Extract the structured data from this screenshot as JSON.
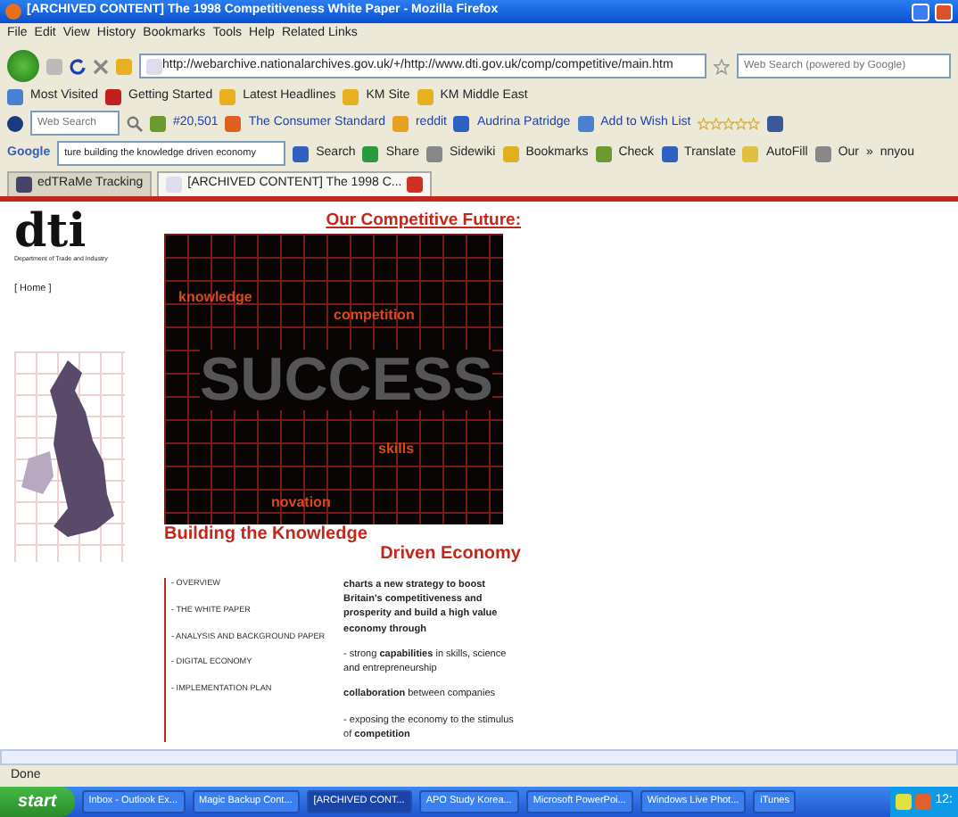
{
  "window": {
    "title": "[ARCHIVED CONTENT] The 1998 Competitiveness White Paper - Mozilla Firefox"
  },
  "menu": [
    "File",
    "Edit",
    "View",
    "History",
    "Bookmarks",
    "Tools",
    "Help",
    "Related Links"
  ],
  "address": {
    "url": "http://webarchive.nationalarchives.gov.uk/+/http://www.dti.gov.uk/comp/competitive/main.htm"
  },
  "search": {
    "placeholder": "Web Search (powered by Google)"
  },
  "bookmarks": [
    "Most Visited",
    "Getting Started",
    "Latest Headlines",
    "KM Site",
    "KM Middle East"
  ],
  "toolbar": {
    "search_placeholder": "Web Search",
    "items": [
      "#20,501",
      "The Consumer Standard",
      "reddit",
      "Audrina Patridge",
      "Add to Wish List"
    ]
  },
  "google_bar": {
    "logo": "Google",
    "query": "ture building the knowledge driven economy",
    "items": [
      "Search",
      "Share",
      "Sidewiki",
      "Bookmarks",
      "Check",
      "Translate",
      "AutoFill",
      "Our",
      "»",
      "nnyou"
    ]
  },
  "tabs": [
    {
      "label": "edTRaMe Tracking",
      "selected": false
    },
    {
      "label": "[ARCHIVED CONTENT] The 1998 C...",
      "selected": true
    }
  ],
  "page": {
    "logo": "dti",
    "logo_caption": "Department of Trade and Industry",
    "home_link": "[ Home ]",
    "heading": "Our Competitive Future:",
    "collage_words": [
      "knowledge",
      "competition",
      "SUCCESS",
      "skills",
      "novation"
    ],
    "subheading": [
      "Building the Knowledge",
      "Driven Economy"
    ],
    "nav": [
      "- OVERVIEW",
      "- THE WHITE PAPER",
      "- ANALYSIS AND BACKGROUND PAPER",
      "- DIGITAL ECONOMY",
      "- IMPLEMENTATION PLAN"
    ],
    "intro": "charts a new strategy to boost Britain's competitiveness and prosperity and build a high value economy through",
    "bullets": [
      "- strong **capabilities** in skills, science and entrepreneurship",
      "**collaboration** between companies",
      "- exposing the economy to the stimulus of **competition**"
    ]
  },
  "status_bar": "Done",
  "taskbar": {
    "start": "start",
    "items": [
      {
        "label": "Inbox - Outlook Ex...",
        "selected": false
      },
      {
        "label": "Magic Backup Cont...",
        "selected": false
      },
      {
        "label": "[ARCHIVED CONT...",
        "selected": true
      },
      {
        "label": "APO Study Korea...",
        "selected": false
      },
      {
        "label": "Microsoft PowerPoi...",
        "selected": false
      },
      {
        "label": "Windows Live Phot...",
        "selected": false
      },
      {
        "label": "iTunes",
        "selected": false
      }
    ],
    "clock": "12:"
  }
}
